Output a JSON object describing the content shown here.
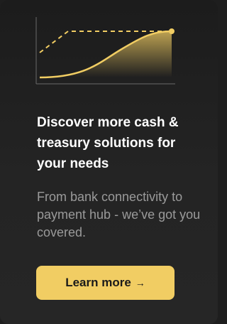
{
  "promo": {
    "headline": "Discover more cash & treasury solutions for your needs",
    "subtext": "From bank connectivity to payment hub - we’ve got you covered.",
    "cta_label": "Learn more",
    "cta_arrow": "→"
  },
  "colors": {
    "background": "#1e1e1e",
    "accent": "#f1cd63",
    "headline": "#ffffff",
    "subtext": "#9a9a9a"
  },
  "icons": {
    "illustration": "growth-curve-chart-icon",
    "cta": "arrow-right-icon"
  }
}
